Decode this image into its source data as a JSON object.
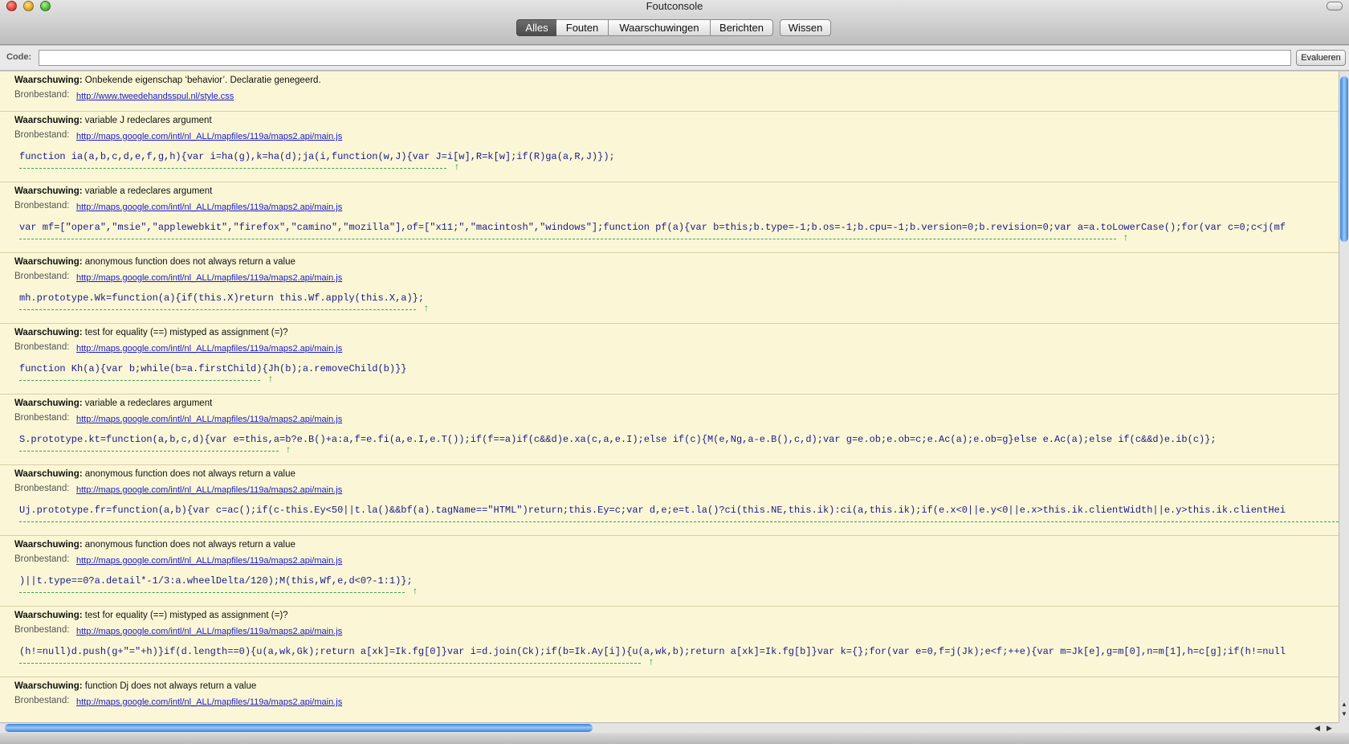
{
  "window": {
    "title": "Foutconsole"
  },
  "toolbar": {
    "segments": [
      "Alles",
      "Fouten",
      "Waarschuwingen",
      "Berichten"
    ],
    "active": "Alles",
    "clear_label": "Wissen"
  },
  "codebar": {
    "label": "Code:",
    "value": "",
    "evaluate_label": "Evalueren"
  },
  "entries": [
    {
      "type": "Waarschuwing:",
      "message": "Onbekende eigenschap ‘behavior’.  Declaratie genegeerd.",
      "source_label": "Bronbestand:",
      "source": "http://www.tweedehandsspul.nl/style.css",
      "code": ""
    },
    {
      "type": "Waarschuwing:",
      "message": "variable J redeclares argument",
      "source_label": "Bronbestand:",
      "source": "http://maps.google.com/intl/nl_ALL/mapfiles/119a/maps2.api/main.js",
      "code": "function ia(a,b,c,d,e,f,g,h){var i=ha(g),k=ha(d);ja(i,function(w,J){var J=i[w],R=k[w];if(R)ga(a,R,J)});"
    },
    {
      "type": "Waarschuwing:",
      "message": "variable a redeclares argument",
      "source_label": "Bronbestand:",
      "source": "http://maps.google.com/intl/nl_ALL/mapfiles/119a/maps2.api/main.js",
      "code": "var mf=[\"opera\",\"msie\",\"applewebkit\",\"firefox\",\"camino\",\"mozilla\"],of=[\"x11;\",\"macintosh\",\"windows\"];function pf(a){var b=this;b.type=-1;b.os=-1;b.cpu=-1;b.version=0;b.revision=0;var a=a.toLowerCase();for(var c=0;c<j(mf"
    },
    {
      "type": "Waarschuwing:",
      "message": "anonymous function does not always return a value",
      "source_label": "Bronbestand:",
      "source": "http://maps.google.com/intl/nl_ALL/mapfiles/119a/maps2.api/main.js",
      "code": "mh.prototype.Wk=function(a){if(this.X)return this.Wf.apply(this.X,a)};"
    },
    {
      "type": "Waarschuwing:",
      "message": "test for equality (==) mistyped as assignment (=)?",
      "source_label": "Bronbestand:",
      "source": "http://maps.google.com/intl/nl_ALL/mapfiles/119a/maps2.api/main.js",
      "code": "function Kh(a){var b;while(b=a.firstChild){Jh(b);a.removeChild(b)}}"
    },
    {
      "type": "Waarschuwing:",
      "message": "variable a redeclares argument",
      "source_label": "Bronbestand:",
      "source": "http://maps.google.com/intl/nl_ALL/mapfiles/119a/maps2.api/main.js",
      "code": "S.prototype.kt=function(a,b,c,d){var e=this,a=b?e.B()+a:a,f=e.fi(a,e.I,e.T());if(f==a)if(c&&d)e.xa(c,a,e.I);else if(c){M(e,Ng,a-e.B(),c,d);var g=e.ob;e.ob=c;e.Ac(a);e.ob=g}else e.Ac(a);else if(c&&d)e.ib(c)};"
    },
    {
      "type": "Waarschuwing:",
      "message": "anonymous function does not always return a value",
      "source_label": "Bronbestand:",
      "source": "http://maps.google.com/intl/nl_ALL/mapfiles/119a/maps2.api/main.js",
      "code": "Uj.prototype.fr=function(a,b){var c=ac();if(c-this.Ey<50||t.la()&&bf(a).tagName==\"HTML\")return;this.Ey=c;var d,e;e=t.la()?ci(this.NE,this.ik):ci(a,this.ik);if(e.x<0||e.y<0||e.x>this.ik.clientWidth||e.y>this.ik.clientHei"
    },
    {
      "type": "Waarschuwing:",
      "message": "anonymous function does not always return a value",
      "source_label": "Bronbestand:",
      "source": "http://maps.google.com/intl/nl_ALL/mapfiles/119a/maps2.api/main.js",
      "code": ")||t.type==0?a.detail*-1/3:a.wheelDelta/120);M(this,Wf,e,d<0?-1:1)};"
    },
    {
      "type": "Waarschuwing:",
      "message": "test for equality (==) mistyped as assignment (=)?",
      "source_label": "Bronbestand:",
      "source": "http://maps.google.com/intl/nl_ALL/mapfiles/119a/maps2.api/main.js",
      "code": "(h!=null)d.push(g+\"=\"+h)}if(d.length==0){u(a,wk,Gk);return a[xk]=Ik.fg[0]}var i=d.join(Ck);if(b=Ik.Ay[i]){u(a,wk,b);return a[xk]=Ik.fg[b]}var k={};for(var e=0,f=j(Jk);e<f;++e){var m=Jk[e],g=m[0],n=m[1],h=c[g];if(h!=null"
    },
    {
      "type": "Waarschuwing:",
      "message": "function Dj does not always return a value",
      "source_label": "Bronbestand:",
      "source": "http://maps.google.com/intl/nl_ALL/mapfiles/119a/maps2.api/main.js",
      "code": ""
    }
  ]
}
